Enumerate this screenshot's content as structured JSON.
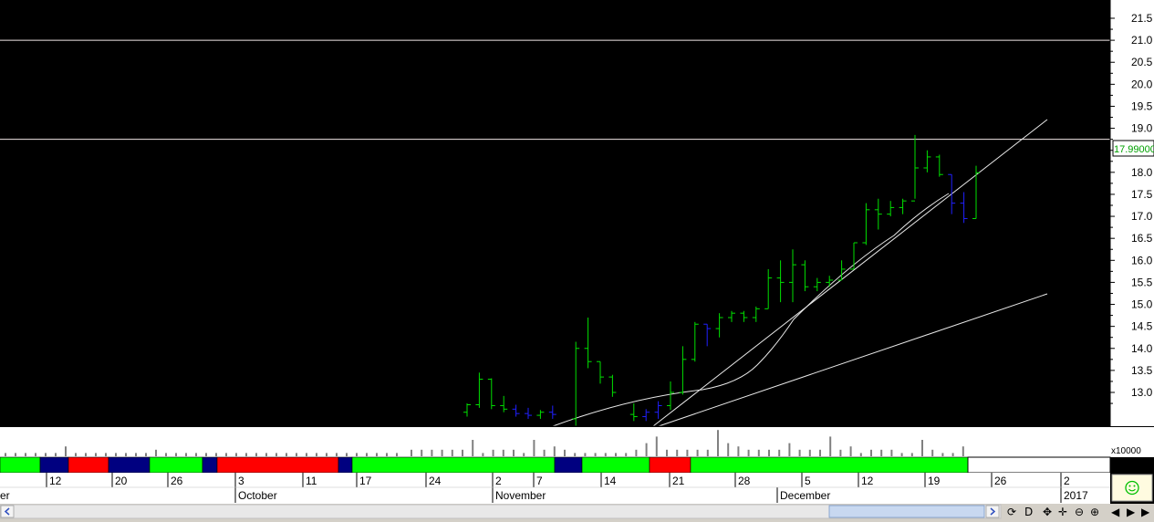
{
  "chart_data": {
    "type": "ohlc",
    "price_axis": {
      "min": 12.5,
      "max": 21.75,
      "ticks": [
        13.0,
        13.5,
        14.0,
        14.5,
        15.0,
        15.5,
        16.0,
        16.5,
        17.0,
        17.5,
        18.0,
        18.5,
        19.0,
        19.5,
        20.0,
        20.5,
        21.0,
        21.5
      ],
      "tick_labels": [
        "13.0",
        "13.5",
        "14.0",
        "14.5",
        "15.0",
        "15.5",
        "16.0",
        "16.5",
        "17.0",
        "17.5",
        "18.0",
        "18.5",
        "19.0",
        "19.5",
        "20.0",
        "20.5",
        "21.0",
        "21.5"
      ]
    },
    "last_price_label": "17.99000",
    "horizontal_lines": [
      21.0,
      18.75
    ],
    "bars": [
      {
        "o": 12.55,
        "h": 12.75,
        "l": 12.45,
        "c": 12.72,
        "color": "green"
      },
      {
        "o": 12.72,
        "h": 13.45,
        "l": 12.65,
        "c": 13.3,
        "color": "green"
      },
      {
        "o": 13.3,
        "h": 13.32,
        "l": 12.62,
        "c": 12.7,
        "color": "green"
      },
      {
        "o": 12.7,
        "h": 12.92,
        "l": 12.55,
        "c": 12.62,
        "color": "green"
      },
      {
        "o": 12.62,
        "h": 12.72,
        "l": 12.45,
        "c": 12.52,
        "color": "blue"
      },
      {
        "o": 12.52,
        "h": 12.65,
        "l": 12.4,
        "c": 12.48,
        "color": "blue"
      },
      {
        "o": 12.48,
        "h": 12.6,
        "l": 12.4,
        "c": 12.55,
        "color": "green"
      },
      {
        "o": 12.55,
        "h": 12.7,
        "l": 12.4,
        "c": 12.5,
        "color": "blue"
      },
      {
        "o": 12.4,
        "h": 14.15,
        "l": 12.2,
        "c": 14.0,
        "color": "green"
      },
      {
        "o": 14.0,
        "h": 14.7,
        "l": 13.55,
        "c": 13.7,
        "color": "green"
      },
      {
        "o": 13.7,
        "h": 13.7,
        "l": 13.2,
        "c": 13.35,
        "color": "green"
      },
      {
        "o": 13.35,
        "h": 13.4,
        "l": 12.9,
        "c": 13.0,
        "color": "green"
      },
      {
        "o": 12.5,
        "h": 12.75,
        "l": 12.35,
        "c": 12.45,
        "color": "green"
      },
      {
        "o": 12.45,
        "h": 12.62,
        "l": 12.35,
        "c": 12.55,
        "color": "blue"
      },
      {
        "o": 12.55,
        "h": 12.8,
        "l": 12.4,
        "c": 12.7,
        "color": "blue"
      },
      {
        "o": 12.7,
        "h": 13.25,
        "l": 12.6,
        "c": 13.0,
        "color": "green"
      },
      {
        "o": 13.0,
        "h": 14.05,
        "l": 12.95,
        "c": 13.75,
        "color": "green"
      },
      {
        "o": 13.75,
        "h": 14.6,
        "l": 13.7,
        "c": 14.55,
        "color": "green"
      },
      {
        "o": 14.55,
        "h": 14.55,
        "l": 14.05,
        "c": 14.45,
        "color": "blue"
      },
      {
        "o": 14.45,
        "h": 14.8,
        "l": 14.25,
        "c": 14.7,
        "color": "green"
      },
      {
        "o": 14.7,
        "h": 14.85,
        "l": 14.6,
        "c": 14.8,
        "color": "green"
      },
      {
        "o": 14.8,
        "h": 14.85,
        "l": 14.6,
        "c": 14.7,
        "color": "green"
      },
      {
        "o": 14.7,
        "h": 14.95,
        "l": 14.6,
        "c": 14.9,
        "color": "green"
      },
      {
        "o": 14.9,
        "h": 15.8,
        "l": 14.9,
        "c": 15.6,
        "color": "green"
      },
      {
        "o": 15.6,
        "h": 16.0,
        "l": 15.05,
        "c": 15.5,
        "color": "green"
      },
      {
        "o": 15.5,
        "h": 16.25,
        "l": 15.05,
        "c": 15.9,
        "color": "green"
      },
      {
        "o": 15.9,
        "h": 16.0,
        "l": 15.3,
        "c": 15.4,
        "color": "green"
      },
      {
        "o": 15.4,
        "h": 15.6,
        "l": 15.3,
        "c": 15.5,
        "color": "green"
      },
      {
        "o": 15.5,
        "h": 15.65,
        "l": 15.4,
        "c": 15.55,
        "color": "green"
      },
      {
        "o": 15.55,
        "h": 16.0,
        "l": 15.55,
        "c": 15.8,
        "color": "green"
      },
      {
        "o": 15.8,
        "h": 16.4,
        "l": 15.8,
        "c": 16.4,
        "color": "green"
      },
      {
        "o": 16.4,
        "h": 17.3,
        "l": 16.35,
        "c": 17.15,
        "color": "green"
      },
      {
        "o": 17.15,
        "h": 17.4,
        "l": 16.7,
        "c": 17.05,
        "color": "green"
      },
      {
        "o": 17.05,
        "h": 17.35,
        "l": 17.0,
        "c": 17.2,
        "color": "green"
      },
      {
        "o": 17.2,
        "h": 17.4,
        "l": 17.05,
        "c": 17.35,
        "color": "green"
      },
      {
        "o": 17.35,
        "h": 18.85,
        "l": 17.4,
        "c": 18.1,
        "color": "green"
      },
      {
        "o": 18.1,
        "h": 18.5,
        "l": 18.0,
        "c": 18.35,
        "color": "green"
      },
      {
        "o": 18.35,
        "h": 18.4,
        "l": 17.9,
        "c": 17.95,
        "color": "green"
      },
      {
        "o": 17.95,
        "h": 17.95,
        "l": 17.05,
        "c": 17.3,
        "color": "blue"
      },
      {
        "o": 17.3,
        "h": 17.55,
        "l": 16.85,
        "c": 16.95,
        "color": "blue"
      },
      {
        "o": 16.95,
        "h": 18.15,
        "l": 16.95,
        "c": 17.99,
        "color": "green"
      }
    ],
    "volume": {
      "multiplier_label": "x10000",
      "bars_left": [
        1,
        1,
        1,
        1,
        1,
        1,
        3,
        1,
        1,
        1,
        1,
        1,
        1,
        1,
        1,
        2,
        1,
        1,
        1,
        1,
        1,
        1,
        1,
        1,
        1,
        1,
        1,
        1,
        1,
        1,
        1,
        1,
        1,
        1,
        1,
        1,
        1,
        1,
        1,
        1
      ],
      "bars_right": [
        2,
        2,
        2,
        2,
        2,
        2,
        5,
        1,
        2,
        2,
        2,
        1,
        5,
        2,
        3,
        2,
        1,
        1,
        1,
        1,
        1,
        1,
        2,
        4,
        6,
        2,
        2,
        2,
        2,
        2,
        8,
        4,
        3,
        2,
        2,
        2,
        2,
        4,
        2,
        2,
        2,
        6,
        2,
        3,
        1,
        2,
        2,
        2,
        1,
        1,
        5,
        2,
        1,
        1,
        3
      ]
    },
    "signal_strip": [
      {
        "from": 0,
        "to": 43,
        "color": "#00ff00"
      },
      {
        "from": 44,
        "to": 74,
        "color": "#000080"
      },
      {
        "from": 75,
        "to": 118,
        "color": "#ff0000"
      },
      {
        "from": 119,
        "to": 163,
        "color": "#000080"
      },
      {
        "from": 164,
        "to": 221,
        "color": "#00ff00"
      },
      {
        "from": 222,
        "to": 237,
        "color": "#000080"
      },
      {
        "from": 238,
        "to": 370,
        "color": "#ff0000"
      },
      {
        "from": 371,
        "to": 385,
        "color": "#000080"
      },
      {
        "from": 386,
        "to": 607,
        "color": "#00ff00"
      },
      {
        "from": 608,
        "to": 637,
        "color": "#000080"
      },
      {
        "from": 638,
        "to": 711,
        "color": "#00ff00"
      },
      {
        "from": 712,
        "to": 756,
        "color": "#ff0000"
      },
      {
        "from": 757,
        "to": 1060,
        "color": "#00ff00"
      }
    ],
    "date_ticks": [
      "12",
      "20",
      "26",
      "3",
      "11",
      "17",
      "24",
      "2",
      "7",
      "14",
      "21",
      "28",
      "5",
      "12",
      "19",
      "26",
      "2"
    ],
    "month_labels": [
      "er",
      "October",
      "November",
      "December",
      "2017"
    ]
  },
  "toolbar": {
    "icons": [
      "loop-icon",
      "move-icon",
      "zoom-out-icon",
      "zoom-in-icon",
      "scroll-left-icon",
      "scroll-right-icon",
      "next-icon"
    ],
    "d_label": "D"
  }
}
